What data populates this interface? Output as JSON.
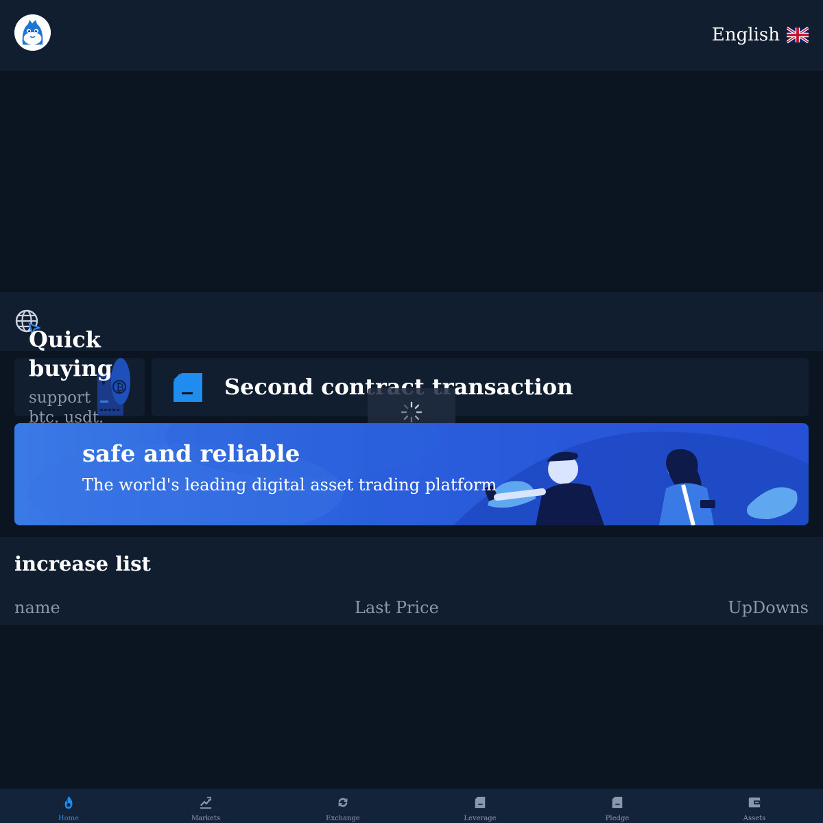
{
  "header": {
    "logo": "mascot-logo",
    "language": {
      "label": "English",
      "flag": "uk-flag-icon"
    }
  },
  "notice": {
    "icon": "globe-icon"
  },
  "quick_buy": {
    "title": "Quick buying",
    "description": "support btc. usdt.",
    "icon": "bitcoin-card-illustration"
  },
  "contract": {
    "title": "Second contract transaction",
    "icon": "document-icon"
  },
  "loading": {
    "icon": "spinner-icon"
  },
  "promo": {
    "title": "safe and reliable",
    "subtitle": "The world's leading digital asset trading platform"
  },
  "increase_list": {
    "title": "increase list",
    "columns": {
      "name": "name",
      "price": "Last Price",
      "updowns": "UpDowns"
    }
  },
  "tabbar": {
    "items": [
      {
        "label": "Home",
        "icon": "flame-icon",
        "active": true
      },
      {
        "label": "Markets",
        "icon": "chart-icon",
        "active": false
      },
      {
        "label": "Exchange",
        "icon": "refresh-icon",
        "active": false
      },
      {
        "label": "Leverage",
        "icon": "document-icon",
        "active": false
      },
      {
        "label": "Pledge",
        "icon": "document-icon",
        "active": false
      },
      {
        "label": "Assets",
        "icon": "wallet-icon",
        "active": false
      }
    ]
  },
  "colors": {
    "background": "#0b1522",
    "panel": "#101e30",
    "accent": "#1f8cf0",
    "muted_text": "#8b98ab",
    "promo_blue": "#2a5fdc"
  }
}
